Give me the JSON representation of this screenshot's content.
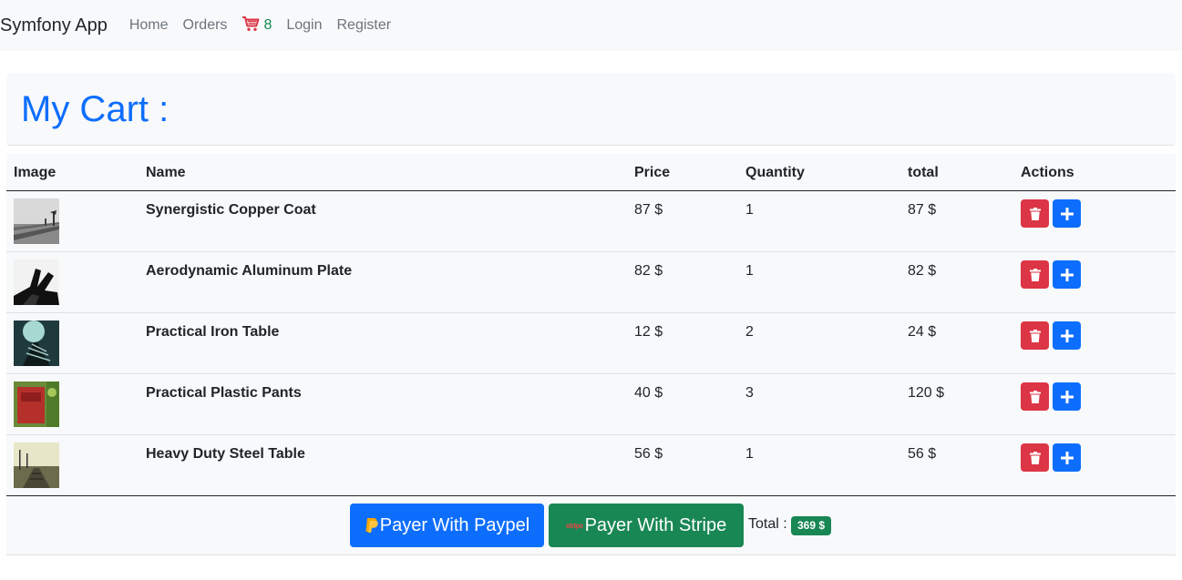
{
  "navbar": {
    "brand": "Symfony App",
    "links": [
      "Home",
      "Orders"
    ],
    "cart_count": "8",
    "auth_links": [
      "Login",
      "Register"
    ]
  },
  "page_title": "My Cart :",
  "table": {
    "headers": [
      "Image",
      "Name",
      "Price",
      "Quantity",
      "total",
      "Actions"
    ],
    "rows": [
      {
        "name": "Synergistic Copper Coat",
        "price": "87 $",
        "quantity": "1",
        "total": "87 $"
      },
      {
        "name": "Aerodynamic Aluminum Plate",
        "price": "82 $",
        "quantity": "1",
        "total": "82 $"
      },
      {
        "name": "Practical Iron Table",
        "price": "12 $",
        "quantity": "2",
        "total": "24 $"
      },
      {
        "name": "Practical Plastic Pants",
        "price": "40 $",
        "quantity": "3",
        "total": "120 $"
      },
      {
        "name": "Heavy Duty Steel Table",
        "price": "56 $",
        "quantity": "1",
        "total": "56 $"
      }
    ]
  },
  "payment": {
    "paypal_label": "Payer With Paypel",
    "stripe_label": "Payer With Stripe",
    "stripe_logo_text": "stripe",
    "total_label": "Total :",
    "total_value": "369 $"
  },
  "colors": {
    "primary": "#0d6efd",
    "danger": "#dc3545",
    "success": "#198754"
  },
  "icons": {
    "cart": "cart-icon",
    "delete": "trash-icon",
    "add": "plus-icon",
    "paypal": "paypal-icon"
  }
}
